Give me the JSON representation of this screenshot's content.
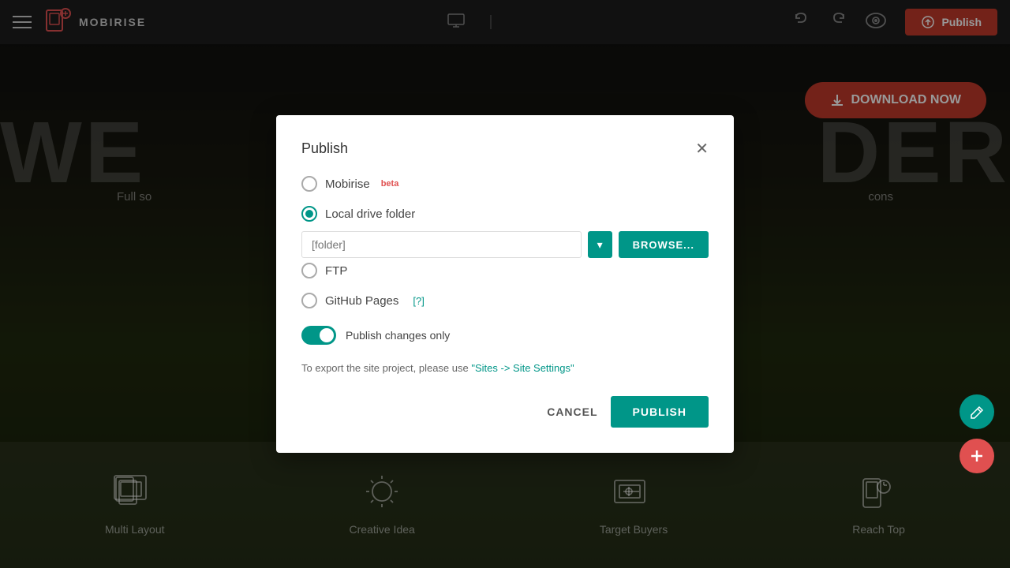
{
  "header": {
    "logo_text": "MOBIRISE",
    "publish_label": "Publish",
    "device_icons": [
      "desktop",
      "tablet",
      "mobile"
    ]
  },
  "hero": {
    "big_text": "WE..........DER",
    "sub_text": "Full so                                               cons",
    "download_label": "DOWNLOAD NOW"
  },
  "features": [
    {
      "label": "Multi Layout",
      "icon": "⊞"
    },
    {
      "label": "Creative Idea",
      "icon": "☀"
    },
    {
      "label": "Target Buyers",
      "icon": "⊡"
    },
    {
      "label": "Reach Top",
      "icon": "⊟"
    }
  ],
  "modal": {
    "title": "Publish",
    "options": [
      {
        "id": "mobirise",
        "label": "Mobirise",
        "badge": "beta",
        "selected": false
      },
      {
        "id": "local",
        "label": "Local drive folder",
        "selected": true
      },
      {
        "id": "ftp",
        "label": "FTP",
        "selected": false
      },
      {
        "id": "github",
        "label": "GitHub Pages",
        "help": "[?]",
        "selected": false
      }
    ],
    "folder_placeholder": "[folder]",
    "browse_label": "BROWSE...",
    "toggle_label": "Publish changes only",
    "toggle_on": true,
    "export_note_prefix": "To export the site project, please use ",
    "export_link_text": "\"Sites -> Site Settings\"",
    "cancel_label": "CANCEL",
    "publish_label": "PUBLISH"
  }
}
